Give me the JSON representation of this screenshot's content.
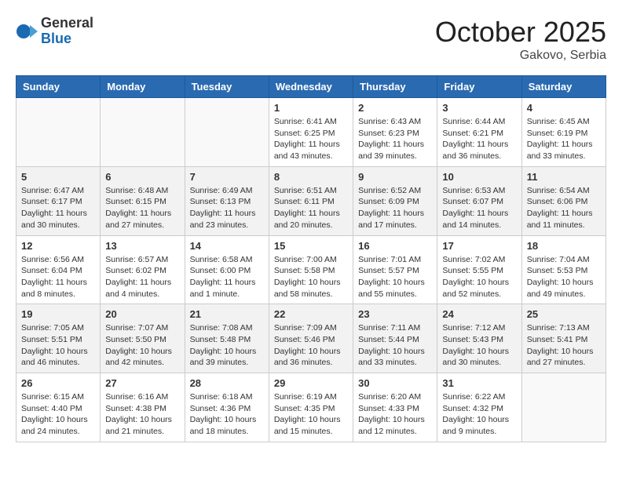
{
  "logo": {
    "general": "General",
    "blue": "Blue"
  },
  "header": {
    "month": "October 2025",
    "location": "Gakovo, Serbia"
  },
  "weekdays": [
    "Sunday",
    "Monday",
    "Tuesday",
    "Wednesday",
    "Thursday",
    "Friday",
    "Saturday"
  ],
  "weeks": [
    [
      {
        "day": "",
        "sunrise": "",
        "sunset": "",
        "daylight": ""
      },
      {
        "day": "",
        "sunrise": "",
        "sunset": "",
        "daylight": ""
      },
      {
        "day": "",
        "sunrise": "",
        "sunset": "",
        "daylight": ""
      },
      {
        "day": "1",
        "sunrise": "Sunrise: 6:41 AM",
        "sunset": "Sunset: 6:25 PM",
        "daylight": "Daylight: 11 hours and 43 minutes."
      },
      {
        "day": "2",
        "sunrise": "Sunrise: 6:43 AM",
        "sunset": "Sunset: 6:23 PM",
        "daylight": "Daylight: 11 hours and 39 minutes."
      },
      {
        "day": "3",
        "sunrise": "Sunrise: 6:44 AM",
        "sunset": "Sunset: 6:21 PM",
        "daylight": "Daylight: 11 hours and 36 minutes."
      },
      {
        "day": "4",
        "sunrise": "Sunrise: 6:45 AM",
        "sunset": "Sunset: 6:19 PM",
        "daylight": "Daylight: 11 hours and 33 minutes."
      }
    ],
    [
      {
        "day": "5",
        "sunrise": "Sunrise: 6:47 AM",
        "sunset": "Sunset: 6:17 PM",
        "daylight": "Daylight: 11 hours and 30 minutes."
      },
      {
        "day": "6",
        "sunrise": "Sunrise: 6:48 AM",
        "sunset": "Sunset: 6:15 PM",
        "daylight": "Daylight: 11 hours and 27 minutes."
      },
      {
        "day": "7",
        "sunrise": "Sunrise: 6:49 AM",
        "sunset": "Sunset: 6:13 PM",
        "daylight": "Daylight: 11 hours and 23 minutes."
      },
      {
        "day": "8",
        "sunrise": "Sunrise: 6:51 AM",
        "sunset": "Sunset: 6:11 PM",
        "daylight": "Daylight: 11 hours and 20 minutes."
      },
      {
        "day": "9",
        "sunrise": "Sunrise: 6:52 AM",
        "sunset": "Sunset: 6:09 PM",
        "daylight": "Daylight: 11 hours and 17 minutes."
      },
      {
        "day": "10",
        "sunrise": "Sunrise: 6:53 AM",
        "sunset": "Sunset: 6:07 PM",
        "daylight": "Daylight: 11 hours and 14 minutes."
      },
      {
        "day": "11",
        "sunrise": "Sunrise: 6:54 AM",
        "sunset": "Sunset: 6:06 PM",
        "daylight": "Daylight: 11 hours and 11 minutes."
      }
    ],
    [
      {
        "day": "12",
        "sunrise": "Sunrise: 6:56 AM",
        "sunset": "Sunset: 6:04 PM",
        "daylight": "Daylight: 11 hours and 8 minutes."
      },
      {
        "day": "13",
        "sunrise": "Sunrise: 6:57 AM",
        "sunset": "Sunset: 6:02 PM",
        "daylight": "Daylight: 11 hours and 4 minutes."
      },
      {
        "day": "14",
        "sunrise": "Sunrise: 6:58 AM",
        "sunset": "Sunset: 6:00 PM",
        "daylight": "Daylight: 11 hours and 1 minute."
      },
      {
        "day": "15",
        "sunrise": "Sunrise: 7:00 AM",
        "sunset": "Sunset: 5:58 PM",
        "daylight": "Daylight: 10 hours and 58 minutes."
      },
      {
        "day": "16",
        "sunrise": "Sunrise: 7:01 AM",
        "sunset": "Sunset: 5:57 PM",
        "daylight": "Daylight: 10 hours and 55 minutes."
      },
      {
        "day": "17",
        "sunrise": "Sunrise: 7:02 AM",
        "sunset": "Sunset: 5:55 PM",
        "daylight": "Daylight: 10 hours and 52 minutes."
      },
      {
        "day": "18",
        "sunrise": "Sunrise: 7:04 AM",
        "sunset": "Sunset: 5:53 PM",
        "daylight": "Daylight: 10 hours and 49 minutes."
      }
    ],
    [
      {
        "day": "19",
        "sunrise": "Sunrise: 7:05 AM",
        "sunset": "Sunset: 5:51 PM",
        "daylight": "Daylight: 10 hours and 46 minutes."
      },
      {
        "day": "20",
        "sunrise": "Sunrise: 7:07 AM",
        "sunset": "Sunset: 5:50 PM",
        "daylight": "Daylight: 10 hours and 42 minutes."
      },
      {
        "day": "21",
        "sunrise": "Sunrise: 7:08 AM",
        "sunset": "Sunset: 5:48 PM",
        "daylight": "Daylight: 10 hours and 39 minutes."
      },
      {
        "day": "22",
        "sunrise": "Sunrise: 7:09 AM",
        "sunset": "Sunset: 5:46 PM",
        "daylight": "Daylight: 10 hours and 36 minutes."
      },
      {
        "day": "23",
        "sunrise": "Sunrise: 7:11 AM",
        "sunset": "Sunset: 5:44 PM",
        "daylight": "Daylight: 10 hours and 33 minutes."
      },
      {
        "day": "24",
        "sunrise": "Sunrise: 7:12 AM",
        "sunset": "Sunset: 5:43 PM",
        "daylight": "Daylight: 10 hours and 30 minutes."
      },
      {
        "day": "25",
        "sunrise": "Sunrise: 7:13 AM",
        "sunset": "Sunset: 5:41 PM",
        "daylight": "Daylight: 10 hours and 27 minutes."
      }
    ],
    [
      {
        "day": "26",
        "sunrise": "Sunrise: 6:15 AM",
        "sunset": "Sunset: 4:40 PM",
        "daylight": "Daylight: 10 hours and 24 minutes."
      },
      {
        "day": "27",
        "sunrise": "Sunrise: 6:16 AM",
        "sunset": "Sunset: 4:38 PM",
        "daylight": "Daylight: 10 hours and 21 minutes."
      },
      {
        "day": "28",
        "sunrise": "Sunrise: 6:18 AM",
        "sunset": "Sunset: 4:36 PM",
        "daylight": "Daylight: 10 hours and 18 minutes."
      },
      {
        "day": "29",
        "sunrise": "Sunrise: 6:19 AM",
        "sunset": "Sunset: 4:35 PM",
        "daylight": "Daylight: 10 hours and 15 minutes."
      },
      {
        "day": "30",
        "sunrise": "Sunrise: 6:20 AM",
        "sunset": "Sunset: 4:33 PM",
        "daylight": "Daylight: 10 hours and 12 minutes."
      },
      {
        "day": "31",
        "sunrise": "Sunrise: 6:22 AM",
        "sunset": "Sunset: 4:32 PM",
        "daylight": "Daylight: 10 hours and 9 minutes."
      },
      {
        "day": "",
        "sunrise": "",
        "sunset": "",
        "daylight": ""
      }
    ]
  ]
}
